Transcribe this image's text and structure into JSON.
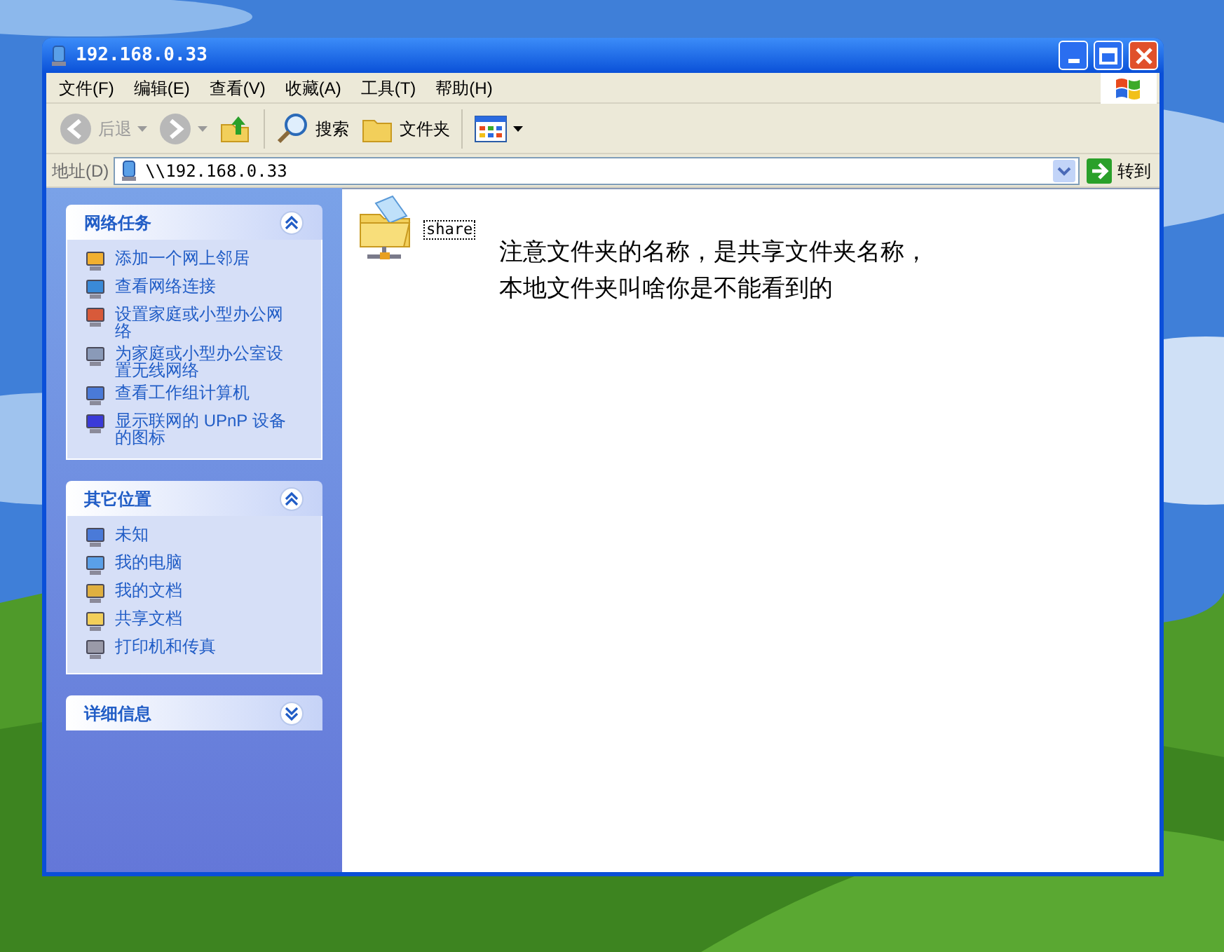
{
  "desktop": {
    "kind": "picture"
  },
  "window": {
    "title": "192.168.0.33"
  },
  "menu": [
    "文件(F)",
    "编辑(E)",
    "查看(V)",
    "收藏(A)",
    "工具(T)",
    "帮助(H)"
  ],
  "toolbar": [
    {
      "kind": "back",
      "label": "后退",
      "disabled": true
    },
    {
      "kind": "forward",
      "disabled": true
    },
    {
      "kind": "up",
      "disabled": false
    },
    {
      "kind": "search",
      "label": "搜索",
      "disabled": false
    },
    {
      "kind": "folders",
      "label": "文件夹",
      "disabled": false
    },
    {
      "kind": "views",
      "disabled": false
    }
  ],
  "address": {
    "label": "地址(D)",
    "value": "\\\\192.168.0.33",
    "go": "转到"
  },
  "panels": [
    {
      "title": "网络任务",
      "expanded": true,
      "items": [
        "添加一个网上邻居",
        "查看网络连接",
        "设置家庭或小型办公网络",
        "为家庭或小型办公室设置无线网络",
        "查看工作组计算机",
        "显示联网的 UPnP 设备的图标"
      ]
    },
    {
      "title": "其它位置",
      "expanded": true,
      "items": [
        "未知",
        "我的电脑",
        "我的文档",
        "共享文档",
        "打印机和传真"
      ]
    },
    {
      "title": "详细信息",
      "expanded": false
    }
  ],
  "files": [
    {
      "name": "share",
      "focused": true
    }
  ],
  "note": [
    "注意文件夹的名称，是共享文件夹名称，",
    "本地文件夹叫啥你是不能看到的"
  ]
}
